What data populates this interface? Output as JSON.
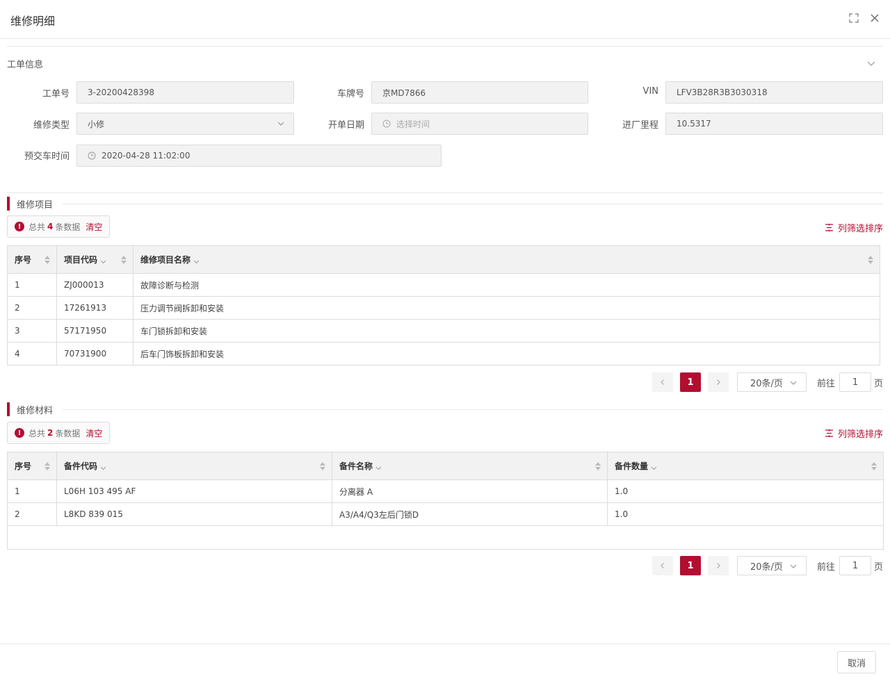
{
  "dialog": {
    "title": "维修明细"
  },
  "work_order_section": {
    "title": "工单信息",
    "fields": {
      "order_no": {
        "label": "工单号",
        "value": "3-20200428398"
      },
      "plate": {
        "label": "车牌号",
        "value": "京MD7866"
      },
      "vin": {
        "label": "VIN",
        "value": "LFV3B28R3B3030318"
      },
      "repair_type": {
        "label": "维修类型",
        "value": "小修"
      },
      "open_date": {
        "label": "开单日期",
        "placeholder": "选择时间"
      },
      "mileage": {
        "label": "进厂里程",
        "value": "10.5317"
      },
      "delivery_time": {
        "label": "预交车时间",
        "value": "2020-04-28 11:02:00"
      }
    }
  },
  "repair_items": {
    "title": "维修项目",
    "count_prefix": "总共",
    "count": "4",
    "count_suffix": "条数据",
    "clear_label": "清空",
    "column_filter_label": "列筛选排序",
    "columns": [
      "序号",
      "项目代码",
      "维修项目名称"
    ],
    "rows": [
      [
        "1",
        "ZJ000013",
        "故障诊断与检测"
      ],
      [
        "2",
        "17261913",
        "压力调节阀拆卸和安装"
      ],
      [
        "3",
        "57171950",
        "车门锁拆卸和安装"
      ],
      [
        "4",
        "70731900",
        "后车门饰板拆卸和安装"
      ]
    ],
    "pager": {
      "page": "1",
      "page_size": "20条/页",
      "goto_label": "前往",
      "goto_value": "1",
      "page_unit": "页"
    }
  },
  "repair_materials": {
    "title": "维修材料",
    "count_prefix": "总共",
    "count": "2",
    "count_suffix": "条数据",
    "clear_label": "清空",
    "column_filter_label": "列筛选排序",
    "columns": [
      "序号",
      "备件代码",
      "备件名称",
      "备件数量"
    ],
    "rows": [
      [
        "1",
        "L06H 103 495 AF",
        "分离器 A",
        "1.0"
      ],
      [
        "2",
        "L8KD 839 015",
        "A3/A4/Q3左后门锁D",
        "1.0"
      ]
    ],
    "pager": {
      "page": "1",
      "page_size": "20条/页",
      "goto_label": "前往",
      "goto_value": "1",
      "page_unit": "页"
    }
  },
  "footer": {
    "cancel_label": "取消"
  },
  "colors": {
    "accent": "#b30e31"
  },
  "icons": [
    "maximize-icon",
    "close-icon",
    "chevron-down-icon",
    "clock-icon",
    "info-icon",
    "filter-icon",
    "sort-icon",
    "chevron-left-icon",
    "chevron-right-icon"
  ]
}
